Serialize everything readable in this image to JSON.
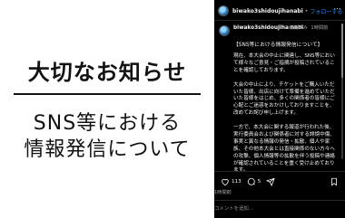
{
  "image": {
    "headline": "大切なお知らせ",
    "subline1": "SNS等における",
    "subline2": "情報発信について"
  },
  "header": {
    "username": "biwako3shidoujihanabi",
    "separator": "•",
    "follow_label": "フォローする",
    "more_label": "…"
  },
  "caption": {
    "username": "biwako3shidoujiha nabi",
    "edited": "編集済み",
    "time": "1時間前",
    "title": "【SNS等における情報発信について】",
    "paragraphs": [
      "現在、本大会の中止に関連し、SNS等において様々なご意見・ご指摘が投稿されていることを確認しております。",
      "大会の中止により、チケットをご購入いただいた皆様、出店に向けて準備を進めていただいた皆様をはじめ、多くの関係者の皆様にご心配とご迷惑をおかけしておりますことを、改めてお詫び申し上げます。",
      "一方で、本大会に関する報道が行われた後、実行委員会および関係者に対する誹謗中傷、事実と異なる情報の発信・拡散、個人や家族、その他本大会とは直接関係のない方々への攻撃、個人情報等の拡散を伴う投稿や連絡が確認されていることを重く受け止めております。"
    ]
  },
  "actions": {
    "like_count": "113",
    "comment_count": "5"
  },
  "time_ago": "1時間前",
  "comment_placeholder": "コメントを追加…"
}
